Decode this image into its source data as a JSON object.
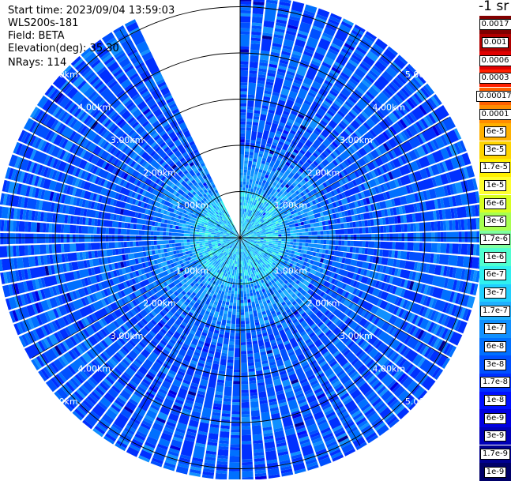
{
  "info": {
    "start_time": "Start time: 2023/09/04 13:59:03",
    "station": "WLS200s-181",
    "field": "Field: BETA",
    "elevation": "Elevation(deg): 35.30",
    "nrays": "NRays: 114"
  },
  "colorbar": {
    "title": "-1 sr",
    "labels": [
      "0.0017",
      "0.001",
      "0.0006",
      "0.0003",
      "0.00017",
      "0.0001",
      "6e-5",
      "3e-5",
      "1.7e-5",
      "1e-5",
      "6e-6",
      "3e-6",
      "1.7e-6",
      "1e-6",
      "6e-7",
      "3e-7",
      "1.7e-7",
      "1e-7",
      "6e-8",
      "3e-8",
      "1.7e-8",
      "1e-8",
      "6e-9",
      "3e-9",
      "1.7e-9",
      "1e-9"
    ],
    "colors": [
      "#800000",
      "#b00000",
      "#e00000",
      "#ff2000",
      "#ff6000",
      "#ff8c00",
      "#ffb000",
      "#ffd400",
      "#fff000",
      "#ffff30",
      "#d8ff20",
      "#a8ff50",
      "#80ffa0",
      "#50ffd0",
      "#30f0f0",
      "#20d0ff",
      "#20b0ff",
      "#1090ff",
      "#0070ff",
      "#0050ff",
      "#0030ff",
      "#0010ff",
      "#0000e0",
      "#0000b8",
      "#000090",
      "#000068"
    ]
  },
  "chart_data": {
    "type": "heatmap",
    "projection": "polar (PPI)",
    "field": "BETA",
    "units": "sr-1",
    "scale": "log",
    "vmin": 1e-09,
    "vmax": 0.0017,
    "nrays": 114,
    "elevation_deg": 35.3,
    "max_range_km": 5.2,
    "missing_sector_deg": [
      336,
      359
    ],
    "range_rings_km": [
      1,
      2,
      3,
      4,
      5
    ],
    "ring_labels": [
      "1.00km",
      "2.00km",
      "3.00km",
      "4.00km",
      "5.00km"
    ],
    "typical_values": {
      "near_range_1km": 3e-07,
      "beyond_2km": 4e-08
    }
  }
}
